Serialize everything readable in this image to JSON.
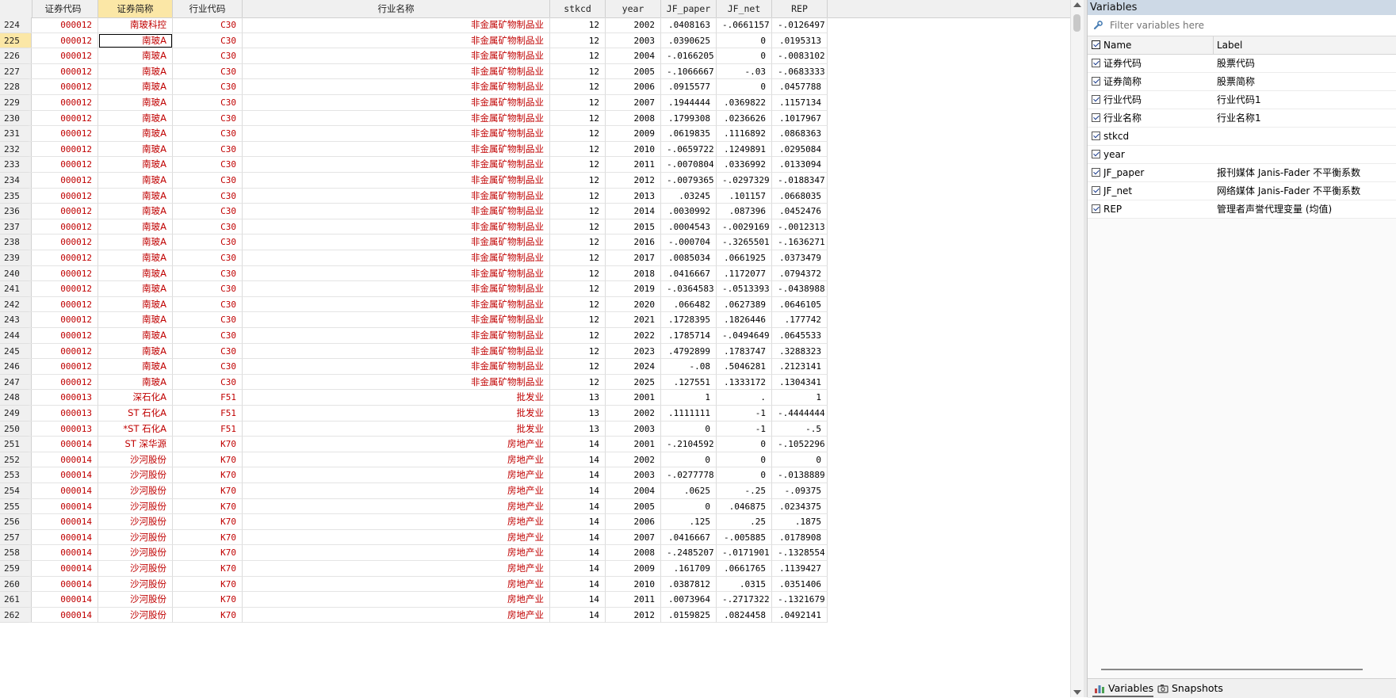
{
  "grid": {
    "columns": [
      "证券代码",
      "证券简称",
      "行业代码",
      "行业名称",
      "stkcd",
      "year",
      "JF_paper",
      "JF_net",
      "REP"
    ],
    "selected_column": "证券简称",
    "selected_row": "225",
    "rows": [
      [
        "224",
        "000012",
        "南玻科控",
        "C30",
        "非金属矿物制品业",
        "12",
        "2002",
        ".0408163",
        "-.0661157",
        "-.0126497"
      ],
      [
        "225",
        "000012",
        "南玻A",
        "C30",
        "非金属矿物制品业",
        "12",
        "2003",
        ".0390625",
        "0",
        ".0195313"
      ],
      [
        "226",
        "000012",
        "南玻A",
        "C30",
        "非金属矿物制品业",
        "12",
        "2004",
        "-.0166205",
        "0",
        "-.0083102"
      ],
      [
        "227",
        "000012",
        "南玻A",
        "C30",
        "非金属矿物制品业",
        "12",
        "2005",
        "-.1066667",
        "-.03",
        "-.0683333"
      ],
      [
        "228",
        "000012",
        "南玻A",
        "C30",
        "非金属矿物制品业",
        "12",
        "2006",
        ".0915577",
        "0",
        ".0457788"
      ],
      [
        "229",
        "000012",
        "南玻A",
        "C30",
        "非金属矿物制品业",
        "12",
        "2007",
        ".1944444",
        ".0369822",
        ".1157134"
      ],
      [
        "230",
        "000012",
        "南玻A",
        "C30",
        "非金属矿物制品业",
        "12",
        "2008",
        ".1799308",
        ".0236626",
        ".1017967"
      ],
      [
        "231",
        "000012",
        "南玻A",
        "C30",
        "非金属矿物制品业",
        "12",
        "2009",
        ".0619835",
        ".1116892",
        ".0868363"
      ],
      [
        "232",
        "000012",
        "南玻A",
        "C30",
        "非金属矿物制品业",
        "12",
        "2010",
        "-.0659722",
        ".1249891",
        ".0295084"
      ],
      [
        "233",
        "000012",
        "南玻A",
        "C30",
        "非金属矿物制品业",
        "12",
        "2011",
        "-.0070804",
        ".0336992",
        ".0133094"
      ],
      [
        "234",
        "000012",
        "南玻A",
        "C30",
        "非金属矿物制品业",
        "12",
        "2012",
        "-.0079365",
        "-.0297329",
        "-.0188347"
      ],
      [
        "235",
        "000012",
        "南玻A",
        "C30",
        "非金属矿物制品业",
        "12",
        "2013",
        ".03245",
        ".101157",
        ".0668035"
      ],
      [
        "236",
        "000012",
        "南玻A",
        "C30",
        "非金属矿物制品业",
        "12",
        "2014",
        ".0030992",
        ".087396",
        ".0452476"
      ],
      [
        "237",
        "000012",
        "南玻A",
        "C30",
        "非金属矿物制品业",
        "12",
        "2015",
        ".0004543",
        "-.0029169",
        "-.0012313"
      ],
      [
        "238",
        "000012",
        "南玻A",
        "C30",
        "非金属矿物制品业",
        "12",
        "2016",
        "-.000704",
        "-.3265501",
        "-.1636271"
      ],
      [
        "239",
        "000012",
        "南玻A",
        "C30",
        "非金属矿物制品业",
        "12",
        "2017",
        ".0085034",
        ".0661925",
        ".0373479"
      ],
      [
        "240",
        "000012",
        "南玻A",
        "C30",
        "非金属矿物制品业",
        "12",
        "2018",
        ".0416667",
        ".1172077",
        ".0794372"
      ],
      [
        "241",
        "000012",
        "南玻A",
        "C30",
        "非金属矿物制品业",
        "12",
        "2019",
        "-.0364583",
        "-.0513393",
        "-.0438988"
      ],
      [
        "242",
        "000012",
        "南玻A",
        "C30",
        "非金属矿物制品业",
        "12",
        "2020",
        ".066482",
        ".0627389",
        ".0646105"
      ],
      [
        "243",
        "000012",
        "南玻A",
        "C30",
        "非金属矿物制品业",
        "12",
        "2021",
        ".1728395",
        ".1826446",
        ".177742"
      ],
      [
        "244",
        "000012",
        "南玻A",
        "C30",
        "非金属矿物制品业",
        "12",
        "2022",
        ".1785714",
        "-.0494649",
        ".0645533"
      ],
      [
        "245",
        "000012",
        "南玻A",
        "C30",
        "非金属矿物制品业",
        "12",
        "2023",
        ".4792899",
        ".1783747",
        ".3288323"
      ],
      [
        "246",
        "000012",
        "南玻A",
        "C30",
        "非金属矿物制品业",
        "12",
        "2024",
        "-.08",
        ".5046281",
        ".2123141"
      ],
      [
        "247",
        "000012",
        "南玻A",
        "C30",
        "非金属矿物制品业",
        "12",
        "2025",
        ".127551",
        ".1333172",
        ".1304341"
      ],
      [
        "248",
        "000013",
        "深石化A",
        "F51",
        "批发业",
        "13",
        "2001",
        "1",
        ".",
        "1"
      ],
      [
        "249",
        "000013",
        "ST 石化A",
        "F51",
        "批发业",
        "13",
        "2002",
        ".1111111",
        "-1",
        "-.4444444"
      ],
      [
        "250",
        "000013",
        "*ST 石化A",
        "F51",
        "批发业",
        "13",
        "2003",
        "0",
        "-1",
        "-.5"
      ],
      [
        "251",
        "000014",
        "ST 深华源",
        "K70",
        "房地产业",
        "14",
        "2001",
        "-.2104592",
        "0",
        "-.1052296"
      ],
      [
        "252",
        "000014",
        "沙河股份",
        "K70",
        "房地产业",
        "14",
        "2002",
        "0",
        "0",
        "0"
      ],
      [
        "253",
        "000014",
        "沙河股份",
        "K70",
        "房地产业",
        "14",
        "2003",
        "-.0277778",
        "0",
        "-.0138889"
      ],
      [
        "254",
        "000014",
        "沙河股份",
        "K70",
        "房地产业",
        "14",
        "2004",
        ".0625",
        "-.25",
        "-.09375"
      ],
      [
        "255",
        "000014",
        "沙河股份",
        "K70",
        "房地产业",
        "14",
        "2005",
        "0",
        ".046875",
        ".0234375"
      ],
      [
        "256",
        "000014",
        "沙河股份",
        "K70",
        "房地产业",
        "14",
        "2006",
        ".125",
        ".25",
        ".1875"
      ],
      [
        "257",
        "000014",
        "沙河股份",
        "K70",
        "房地产业",
        "14",
        "2007",
        ".0416667",
        "-.005885",
        ".0178908"
      ],
      [
        "258",
        "000014",
        "沙河股份",
        "K70",
        "房地产业",
        "14",
        "2008",
        "-.2485207",
        "-.0171901",
        "-.1328554"
      ],
      [
        "259",
        "000014",
        "沙河股份",
        "K70",
        "房地产业",
        "14",
        "2009",
        ".161709",
        ".0661765",
        ".1139427"
      ],
      [
        "260",
        "000014",
        "沙河股份",
        "K70",
        "房地产业",
        "14",
        "2010",
        ".0387812",
        ".0315",
        ".0351406"
      ],
      [
        "261",
        "000014",
        "沙河股份",
        "K70",
        "房地产业",
        "14",
        "2011",
        ".0073964",
        "-.2717322",
        "-.1321679"
      ],
      [
        "262",
        "000014",
        "沙河股份",
        "K70",
        "房地产业",
        "14",
        "2012",
        ".0159825",
        ".0824458",
        ".0492141"
      ]
    ]
  },
  "variables_pane": {
    "title": "Variables",
    "filter_placeholder": "Filter variables here",
    "col_name": "Name",
    "col_label": "Label",
    "items": [
      {
        "name": "证券代码",
        "label": "股票代码",
        "checked": true
      },
      {
        "name": "证券简称",
        "label": "股票简称",
        "checked": true
      },
      {
        "name": "行业代码",
        "label": "行业代码1",
        "checked": true
      },
      {
        "name": "行业名称",
        "label": "行业名称1",
        "checked": true
      },
      {
        "name": "stkcd",
        "label": "",
        "checked": true
      },
      {
        "name": "year",
        "label": "",
        "checked": true
      },
      {
        "name": "JF_paper",
        "label": "报刊媒体 Janis-Fader 不平衡系数",
        "checked": true
      },
      {
        "name": "JF_net",
        "label": "网络媒体 Janis-Fader 不平衡系数",
        "checked": true
      },
      {
        "name": "REP",
        "label": "管理者声誉代理变量 (均值)",
        "checked": true
      }
    ],
    "tabs": [
      {
        "label": "Variables",
        "icon": "variables-icon",
        "active": true
      },
      {
        "label": "Snapshots",
        "icon": "camera-icon",
        "active": false
      }
    ]
  },
  "colors": {
    "string_text": "#c00000",
    "selected_header": "#fbe7a6",
    "pane_title_bg": "#cdd9e6"
  }
}
